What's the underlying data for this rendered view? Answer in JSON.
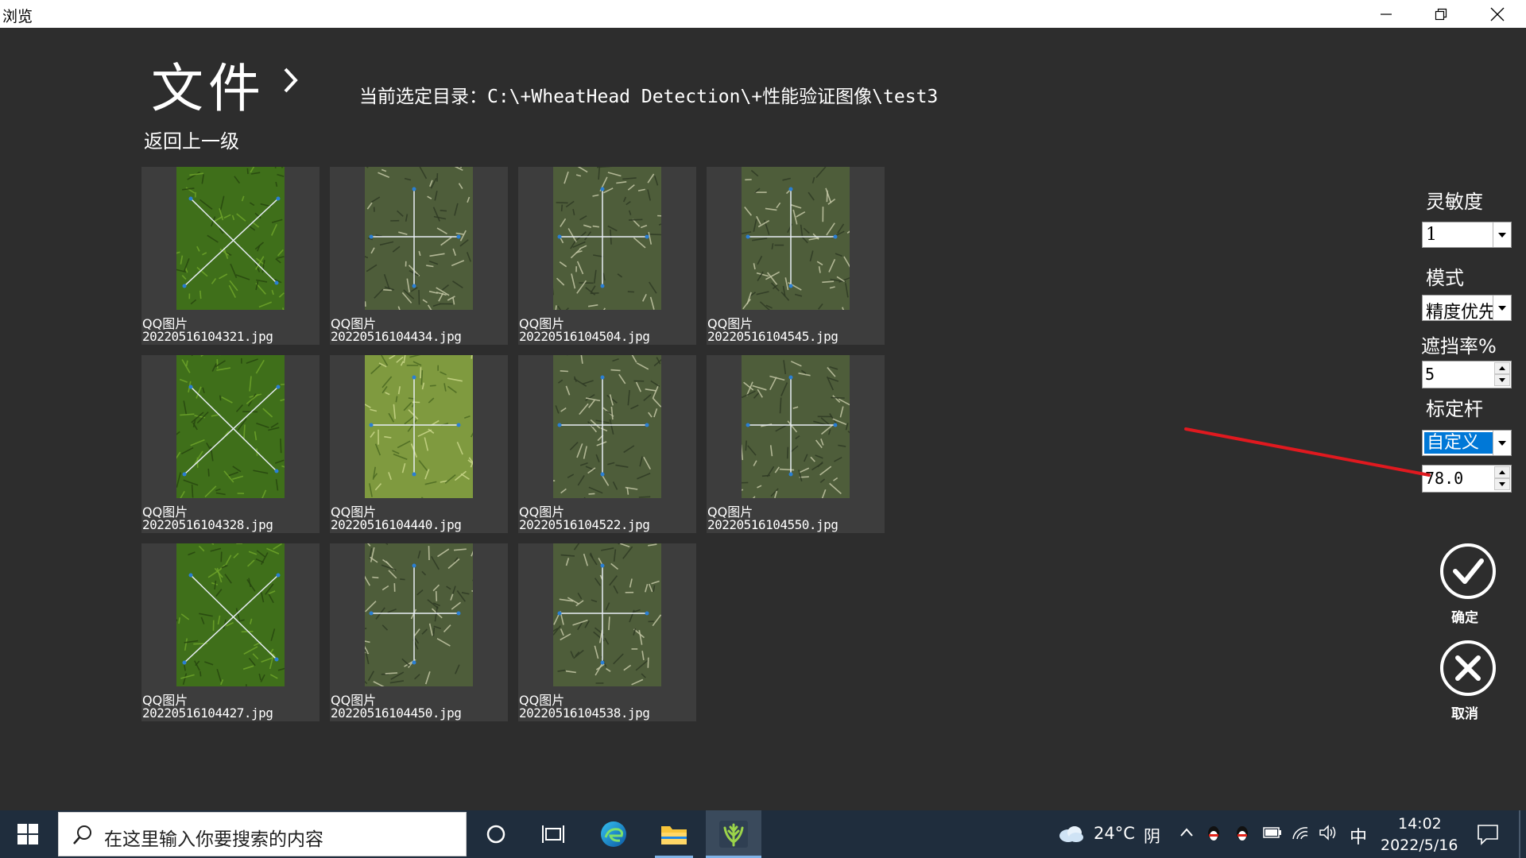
{
  "window": {
    "title": "浏览"
  },
  "header": {
    "title": "文件",
    "current_dir_label": "当前选定目录：",
    "current_dir_path": "C:\\+WheatHead Detection\\+性能验证图像\\test3"
  },
  "nav": {
    "back_label": "返回上一级"
  },
  "files": [
    {
      "name_line1": "QQ图片",
      "name_line2": "20220516104321.jpg",
      "style": "green-x"
    },
    {
      "name_line1": "QQ图片",
      "name_line2": "20220516104434.jpg",
      "style": "spiky-plus"
    },
    {
      "name_line1": "QQ图片",
      "name_line2": "20220516104504.jpg",
      "style": "spiky-plus"
    },
    {
      "name_line1": "QQ图片",
      "name_line2": "20220516104545.jpg",
      "style": "spiky-plus"
    },
    {
      "name_line1": "QQ图片",
      "name_line2": "20220516104328.jpg",
      "style": "green-x"
    },
    {
      "name_line1": "QQ图片",
      "name_line2": "20220516104440.jpg",
      "style": "light-plus"
    },
    {
      "name_line1": "QQ图片",
      "name_line2": "20220516104522.jpg",
      "style": "spiky-plus"
    },
    {
      "name_line1": "QQ图片",
      "name_line2": "20220516104550.jpg",
      "style": "spiky-plus"
    },
    {
      "name_line1": "QQ图片",
      "name_line2": "20220516104427.jpg",
      "style": "green-x"
    },
    {
      "name_line1": "QQ图片",
      "name_line2": "20220516104450.jpg",
      "style": "spiky-plus"
    },
    {
      "name_line1": "QQ图片",
      "name_line2": "20220516104538.jpg",
      "style": "spiky-plus"
    }
  ],
  "settings": {
    "sensitivity": {
      "label": "灵敏度",
      "value": "1"
    },
    "mode": {
      "label": "模式",
      "value": "精度优先"
    },
    "occlusion": {
      "label": "遮挡率%",
      "value": "5"
    },
    "calibration": {
      "label": "标定杆",
      "value": "自定义",
      "length": "78.0"
    }
  },
  "actions": {
    "confirm_label": "确定",
    "cancel_label": "取消"
  },
  "taskbar": {
    "search_placeholder": "在这里输入你要搜索的内容",
    "weather_temp": "24°C",
    "weather_desc": "阴",
    "ime": "中",
    "time": "14:02",
    "date": "2022/5/16"
  },
  "colors": {
    "background": "#2d2d2d",
    "tile": "#3d3d3d",
    "accent_selected": "#0078d7",
    "annotation_arrow": "#e0191f",
    "taskbar": "#1f2d3d"
  }
}
